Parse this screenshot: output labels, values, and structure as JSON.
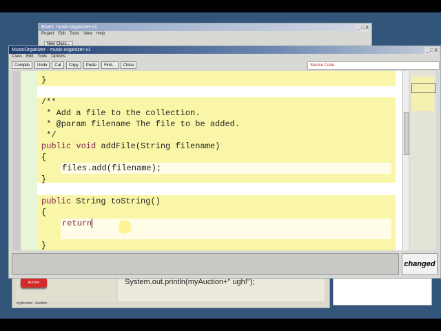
{
  "back_window": {
    "title": "BlueJ: music-organizer-v1",
    "menu": [
      "Project",
      "Edit",
      "Tools",
      "View",
      "Help"
    ],
    "new_class": "New Class...",
    "object_label": "myAuction : Auction",
    "object_button": "Auction",
    "code_pad": "System.out.println(myAuction+\" ugh!\");"
  },
  "editor": {
    "title": "MusicOrganizer - music-organizer-v1",
    "window_controls": "_ □ X",
    "menu": [
      "Class",
      "Edit",
      "Tools",
      "Options"
    ],
    "toolbar": [
      "Compile",
      "Undo",
      "Cut",
      "Copy",
      "Paste",
      "Find...",
      "Close"
    ],
    "view_select": "Source Code",
    "code": {
      "l0": "}",
      "l1": "/**",
      "l2": " * Add a file to the collection.",
      "l3": " * @param filename The file to be added.",
      "l4": " */",
      "l5a": "public void ",
      "l5b": "addFile(String filename)",
      "l6": "{",
      "l7": "files.add(filename);",
      "l8": "}",
      "l9a": "public ",
      "l9b": "String toString()",
      "l10": "{",
      "l11": "return",
      "l12": "}"
    },
    "status": "changed"
  },
  "colors": {
    "desktop": "#34557a",
    "class_block": "#f9f6a8",
    "keyword": "#7a1e4a"
  }
}
